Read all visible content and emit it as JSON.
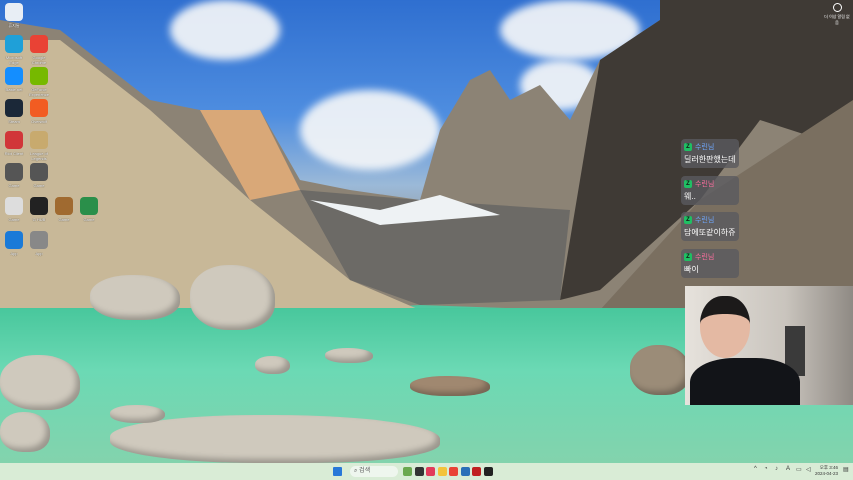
{
  "desktop": {
    "icons": [
      {
        "label": "휴지통",
        "color": "#e8eef5"
      },
      {
        "label": "Microsoft Edge",
        "color": "#1fa0d8"
      },
      {
        "label": "Google Chrome",
        "color": "#e94235"
      },
      {
        "label": "Battle.net",
        "color": "#148eff"
      },
      {
        "label": "GeForce Experience",
        "color": "#76b900"
      },
      {
        "label": "Steam",
        "color": "#1b2838"
      },
      {
        "label": "Overwolf",
        "color": "#f25c22"
      },
      {
        "label": "Riot Client",
        "color": "#d13639"
      },
      {
        "label": "League of Legends",
        "color": "#c8aa6e"
      },
      {
        "label": "Game",
        "color": "#555"
      },
      {
        "label": "Game",
        "color": "#555"
      },
      {
        "label": "Game",
        "color": "#ddd"
      },
      {
        "label": "G HUB",
        "color": "#222"
      },
      {
        "label": "Game",
        "color": "#a06a30"
      },
      {
        "label": "Game",
        "color": "#2a8f4a"
      },
      {
        "label": "App",
        "color": "#1a7ad8"
      },
      {
        "label": "App",
        "color": "#888"
      }
    ]
  },
  "chat": {
    "messages": [
      {
        "badge": "Z",
        "user": "수린님",
        "text": "딜러한판했는데",
        "user_color": "#6fa8ff"
      },
      {
        "badge": "Z",
        "user": "수린님",
        "text": "웨..",
        "user_color": "#ff6fa0"
      },
      {
        "badge": "Z",
        "user": "수린님",
        "text": "담에또같이하쥬",
        "user_color": "#6fa8ff"
      },
      {
        "badge": "Z",
        "user": "수린님",
        "text": "빠이",
        "user_color": "#ff6fa0"
      }
    ]
  },
  "corner_widget": {
    "text": "더 이상 알림 없음"
  },
  "taskbar": {
    "search_placeholder": "검색",
    "apps": [
      {
        "name": "widgets",
        "color": "#6aa84f"
      },
      {
        "name": "task-view",
        "color": "#333"
      },
      {
        "name": "app-red",
        "color": "#e23a5a"
      },
      {
        "name": "file-explorer",
        "color": "#f3c33b"
      },
      {
        "name": "chrome",
        "color": "#e94235"
      },
      {
        "name": "app-blue",
        "color": "#2a6fb8"
      },
      {
        "name": "app-game",
        "color": "#c02020"
      },
      {
        "name": "app-terminal",
        "color": "#222"
      }
    ],
    "tray": {
      "chevron": "^",
      "time": "오후 3:46",
      "date": "2024-04-23"
    }
  }
}
